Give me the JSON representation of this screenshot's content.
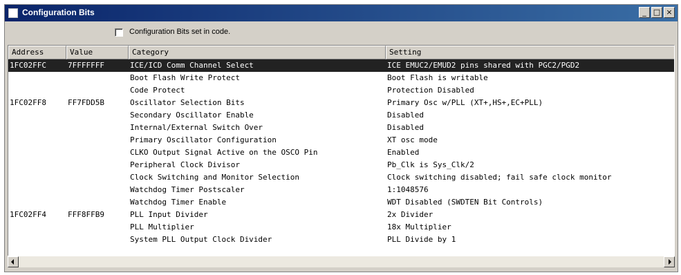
{
  "window": {
    "title": "Configuration Bits",
    "buttons": {
      "minimize": "_",
      "maximize": "□",
      "close": "×"
    }
  },
  "toolbar": {
    "checkbox_label": "Configuration Bits set in code.",
    "checked": false
  },
  "table": {
    "columns": [
      "Address",
      "Value",
      "Category",
      "Setting"
    ],
    "rows": [
      {
        "address": "1FC02FFC",
        "value": "7FFFFFFF",
        "category": "ICE/ICD Comm Channel Select",
        "setting": "ICE EMUC2/EMUD2 pins shared with PGC2/PGD2",
        "selected": true
      },
      {
        "address": "",
        "value": "",
        "category": "Boot Flash Write Protect",
        "setting": "Boot Flash is writable"
      },
      {
        "address": "",
        "value": "",
        "category": "Code Protect",
        "setting": "Protection Disabled"
      },
      {
        "address": "1FC02FF8",
        "value": "FF7FDD5B",
        "category": "Oscillator Selection Bits",
        "setting": "Primary Osc w/PLL (XT+,HS+,EC+PLL)"
      },
      {
        "address": "",
        "value": "",
        "category": "Secondary Oscillator Enable",
        "setting": "Disabled"
      },
      {
        "address": "",
        "value": "",
        "category": "Internal/External Switch Over",
        "setting": "Disabled"
      },
      {
        "address": "",
        "value": "",
        "category": "Primary Oscillator Configuration",
        "setting": "XT osc mode"
      },
      {
        "address": "",
        "value": "",
        "category": "CLKO Output Signal Active on the OSCO Pin",
        "setting": "Enabled"
      },
      {
        "address": "",
        "value": "",
        "category": "Peripheral Clock Divisor",
        "setting": "Pb_Clk is Sys_Clk/2"
      },
      {
        "address": "",
        "value": "",
        "category": "Clock Switching and Monitor Selection",
        "setting": "Clock switching disabled; fail safe clock monitor"
      },
      {
        "address": "",
        "value": "",
        "category": "Watchdog Timer Postscaler",
        "setting": "1:1048576"
      },
      {
        "address": "",
        "value": "",
        "category": "Watchdog Timer Enable",
        "setting": "WDT Disabled (SWDTEN Bit Controls)"
      },
      {
        "address": "1FC02FF4",
        "value": "FFF8FFB9",
        "category": "PLL Input Divider",
        "setting": "2x Divider"
      },
      {
        "address": "",
        "value": "",
        "category": "PLL Multiplier",
        "setting": "18x Multiplier"
      },
      {
        "address": "",
        "value": "",
        "category": "System PLL Output Clock Divider",
        "setting": "PLL Divide by 1"
      }
    ]
  }
}
